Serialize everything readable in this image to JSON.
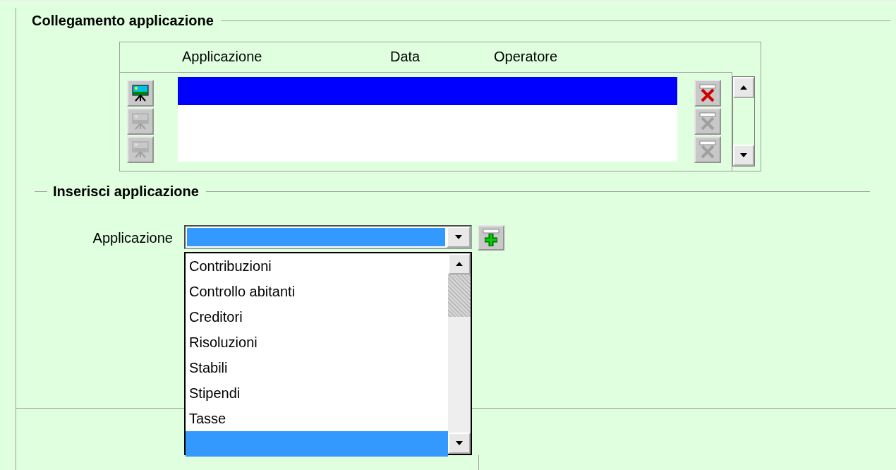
{
  "link_section": {
    "legend": "Collegamento applicazione",
    "table": {
      "columns": [
        "Applicazione",
        "Data",
        "Operatore"
      ],
      "rows": [
        {
          "selected": true,
          "disabled": false
        },
        {
          "selected": false,
          "disabled": true
        },
        {
          "selected": false,
          "disabled": true
        }
      ]
    }
  },
  "insert_section": {
    "legend": "Inserisci applicazione",
    "field_label": "Applicazione",
    "combo": {
      "selected": true
    },
    "options": [
      {
        "label": "Contribuzioni",
        "selected": false
      },
      {
        "label": "Controllo abitanti",
        "selected": false
      },
      {
        "label": "Creditori",
        "selected": false
      },
      {
        "label": "Risoluzioni",
        "selected": false
      },
      {
        "label": "Stabili",
        "selected": false
      },
      {
        "label": "Stipendi",
        "selected": false
      },
      {
        "label": "Tasse",
        "selected": false
      },
      {
        "selected": true
      }
    ]
  }
}
